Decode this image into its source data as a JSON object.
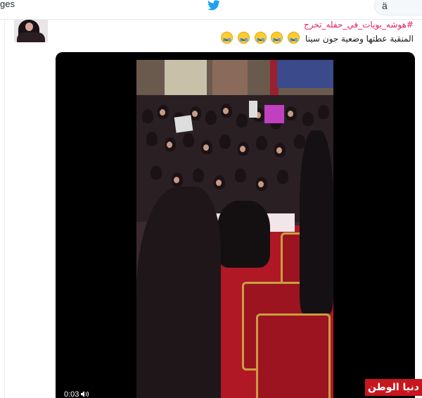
{
  "header": {
    "nav_label": "ges",
    "search_text": "ä"
  },
  "tweet": {
    "hashtag": "#هوشه_بويات_في_حفله_تخرج",
    "text": "المنقبة عطتها وضعية جون سينا",
    "emoji_count": 5,
    "emoji_name": "face-with-tears-of-joy-icon"
  },
  "video": {
    "timecode": "0:03",
    "volume_icon": "volume-icon"
  },
  "watermark": {
    "text": "دنيا الوطن"
  },
  "colors": {
    "twitter_blue": "#1da1f2",
    "hashtag_red": "#e0245e",
    "watermark_red": "#c8161d"
  }
}
